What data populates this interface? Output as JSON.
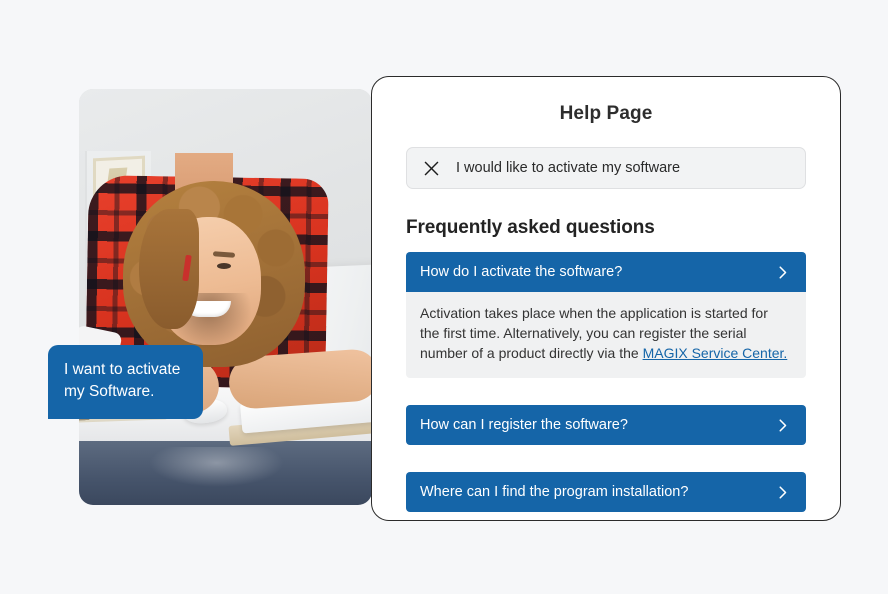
{
  "colors": {
    "page_background": "#f6f7f9",
    "accent_blue": "#1565a8",
    "card_background": "#ffffff",
    "card_border": "#2b2b2b",
    "query_background": "#f2f3f4",
    "answer_background": "#f0f1f2",
    "bubble_text": "#ffffff"
  },
  "speech_bubble": {
    "text": "I want to activate my Software."
  },
  "photo": {
    "alt": "Smiling man with curly hair in a red plaid shirt typing at a desktop computer"
  },
  "card": {
    "title": "Help Page",
    "query": {
      "icon": "close-icon",
      "value": "I would like to activate my software"
    },
    "faq_heading": "Frequently asked questions",
    "faq": [
      {
        "question": "How do I activate the software?",
        "icon": "chevron-right-icon",
        "expanded": true,
        "answer_before_link": "Activation takes place when the application is started for the first time. Alternatively, you can register the serial number of a product directly via the ",
        "answer_link": "MAGIX Service Center.",
        "answer_after_link": ""
      },
      {
        "question": "How can I register the software?",
        "icon": "chevron-right-icon",
        "expanded": false
      },
      {
        "question": "Where can I find the program installation?",
        "icon": "chevron-right-icon",
        "expanded": false
      }
    ]
  }
}
